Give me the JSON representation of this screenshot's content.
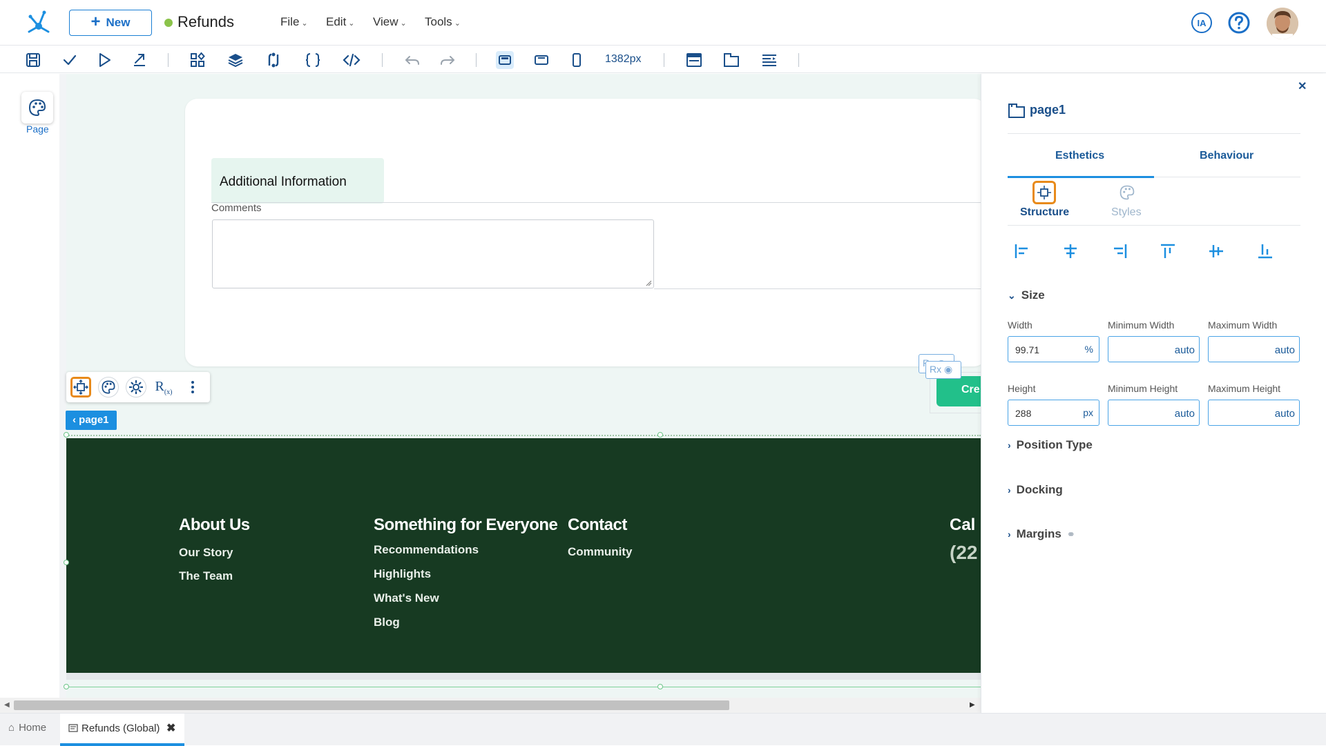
{
  "app": {
    "title": "Refunds",
    "new_button": "New",
    "menus": [
      "File",
      "Edit",
      "View",
      "Tools"
    ],
    "ia_label": "IA"
  },
  "toolbar": {
    "zoom": "1382px"
  },
  "left_strip": {
    "page_label": "Page"
  },
  "canvas": {
    "section_title": "Additional Information",
    "comments_label": "Comments",
    "rx_label": "Rx",
    "create_button": "Cre",
    "breadcrumb": "page1",
    "footer": {
      "col1": {
        "title": "About Us",
        "links": [
          "Our Story",
          "The Team"
        ]
      },
      "col2": {
        "title": "Something for Everyone",
        "links": [
          "Recommendations",
          "Highlights",
          "What's New",
          "Blog"
        ]
      },
      "col3": {
        "title": "Contact",
        "links": [
          "Community"
        ]
      },
      "call_partial": "Cal",
      "phone_partial": "(22"
    }
  },
  "panel": {
    "page_name": "page1",
    "tabs": [
      "Esthetics",
      "Behaviour"
    ],
    "subtabs": [
      "Structure",
      "Styles"
    ],
    "size_title": "Size",
    "width_label": "Width",
    "width_value": "99.71",
    "width_unit": "%",
    "min_width_label": "Minimum Width",
    "min_width_value": "auto",
    "max_width_label": "Maximum Width",
    "max_width_value": "auto",
    "height_label": "Height",
    "height_value": "288",
    "height_unit": "px",
    "min_height_label": "Minimum Height",
    "min_height_value": "auto",
    "max_height_label": "Maximum Height",
    "max_height_value": "auto",
    "sections": [
      "Position Type",
      "Docking",
      "Margins"
    ]
  },
  "bottom_tabs": {
    "home": "Home",
    "active": "Refunds (Global)"
  },
  "colors": {
    "accent": "#1c8fe0",
    "footer_bg": "#173a22",
    "create_button": "#22c08a",
    "selection": "#e88a1a"
  }
}
